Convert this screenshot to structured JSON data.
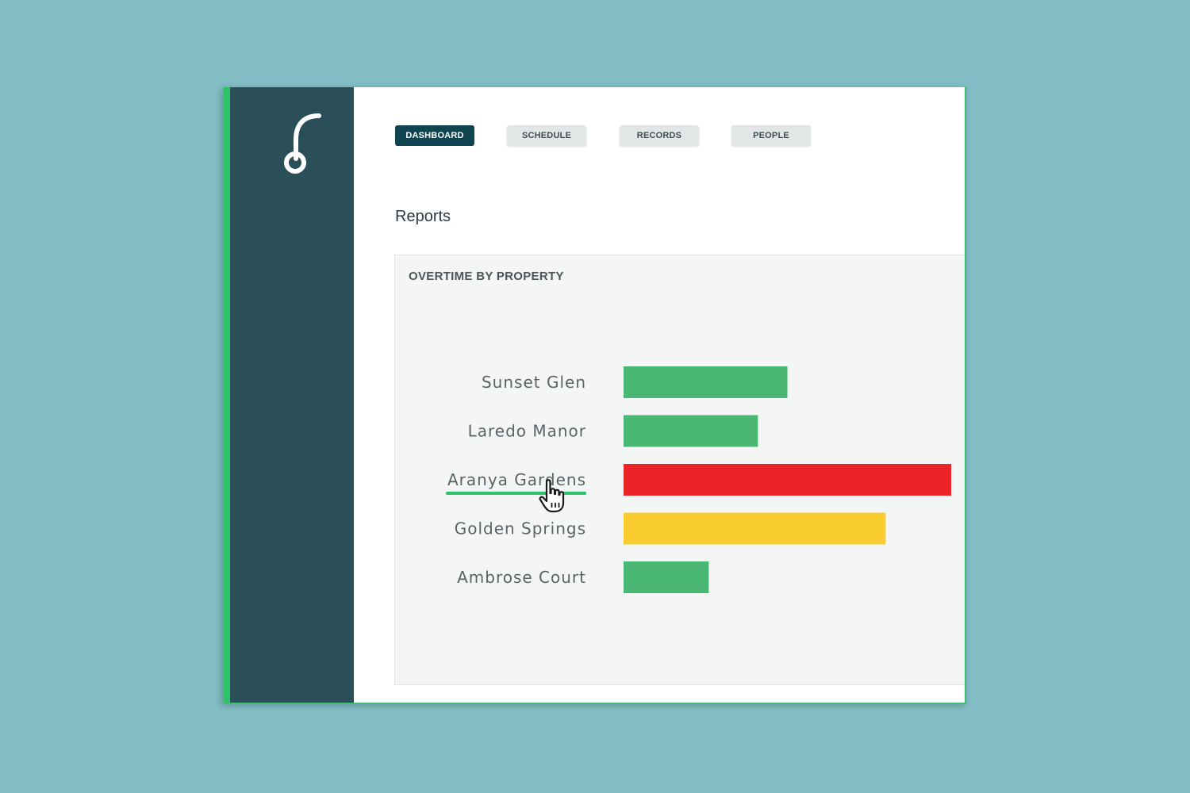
{
  "logo_icon": "hook-logo-icon",
  "nav": {
    "tabs": [
      {
        "label": "DASHBOARD",
        "active": true
      },
      {
        "label": "SCHEDULE",
        "active": false
      },
      {
        "label": "RECORDS",
        "active": false
      },
      {
        "label": "PEOPLE",
        "active": false
      }
    ]
  },
  "page": {
    "title": "Reports"
  },
  "report": {
    "title": "OVERTIME BY PROPERTY"
  },
  "colors": {
    "sidebar": "#2a4f59",
    "accent": "#2ec26b",
    "active_tab": "#114451",
    "ok": "#4ab774",
    "warning": "#f9cc30",
    "critical": "#ec2427"
  },
  "chart_data": {
    "type": "bar",
    "orientation": "horizontal",
    "categories": [
      "Sunset Glen",
      "Laredo Manor",
      "Aranya Gardens",
      "Golden Springs",
      "Ambrose Court"
    ],
    "values": [
      50,
      41,
      100,
      80,
      26
    ],
    "bar_colors": [
      "#4ab774",
      "#4ab774",
      "#ec2427",
      "#f9cc30",
      "#4ab774"
    ],
    "highlighted_category": "Aranya Gardens",
    "title": "OVERTIME BY PROPERTY",
    "xlabel": "",
    "ylabel": "",
    "xlim": [
      0,
      100
    ],
    "grid": false,
    "legend": "none"
  }
}
